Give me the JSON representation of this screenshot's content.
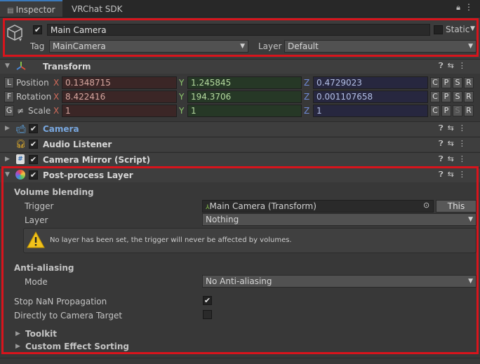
{
  "tabs": [
    {
      "label": "Inspector"
    },
    {
      "label": "VRChat SDK"
    }
  ],
  "tab_icons": {
    "lock": "lock-icon",
    "menu": "kebab-menu-icon"
  },
  "gameobject": {
    "name": "Main Camera",
    "active": true,
    "static_label": "Static",
    "tag_label": "Tag",
    "tag_value": "MainCamera",
    "layer_label": "Layer",
    "layer_value": "Default"
  },
  "transform": {
    "title": "Transform",
    "axis_labels": {
      "x": "X",
      "y": "Y",
      "z": "Z"
    },
    "rows": [
      {
        "prefix": "L",
        "label": "Position",
        "x": "0.1348715",
        "y": "1.245845",
        "z": "0.4729023",
        "buttons": [
          "C",
          "P",
          "S",
          "R"
        ]
      },
      {
        "prefix": "F",
        "label": "Rotation",
        "x": "8.422416",
        "y": "194.3706",
        "z": "0.001107658",
        "buttons": [
          "C",
          "P",
          "S",
          "R"
        ]
      },
      {
        "prefix": "G",
        "prefix2": "≠",
        "label": "Scale",
        "x": "1",
        "y": "1",
        "z": "1",
        "buttons": [
          "C",
          "P",
          "S",
          "R"
        ]
      }
    ]
  },
  "components": {
    "camera": {
      "title": "Camera",
      "enabled": true
    },
    "audio_listener": {
      "title": "Audio Listener",
      "enabled": true
    },
    "camera_mirror": {
      "title": "Camera Mirror (Script)",
      "enabled": true
    },
    "post_process": {
      "title": "Post-process Layer",
      "enabled": true
    }
  },
  "post_process": {
    "volume_blending_header": "Volume blending",
    "trigger_label": "Trigger",
    "trigger_value": "Main Camera (Transform)",
    "this_button": "This",
    "layer_label": "Layer",
    "layer_value": "Nothing",
    "warning_text": "No layer has been set, the trigger will never be affected by volumes.",
    "anti_aliasing_header": "Anti-aliasing",
    "mode_label": "Mode",
    "mode_value": "No Anti-aliasing",
    "stop_nan_label": "Stop NaN Propagation",
    "stop_nan_checked": true,
    "direct_camera_label": "Directly to Camera Target",
    "direct_camera_checked": false,
    "toolkit_label": "Toolkit",
    "custom_sorting_label": "Custom Effect Sorting"
  },
  "colors": {
    "highlight": "#d8141c",
    "camera_title": "#79a8e0"
  }
}
